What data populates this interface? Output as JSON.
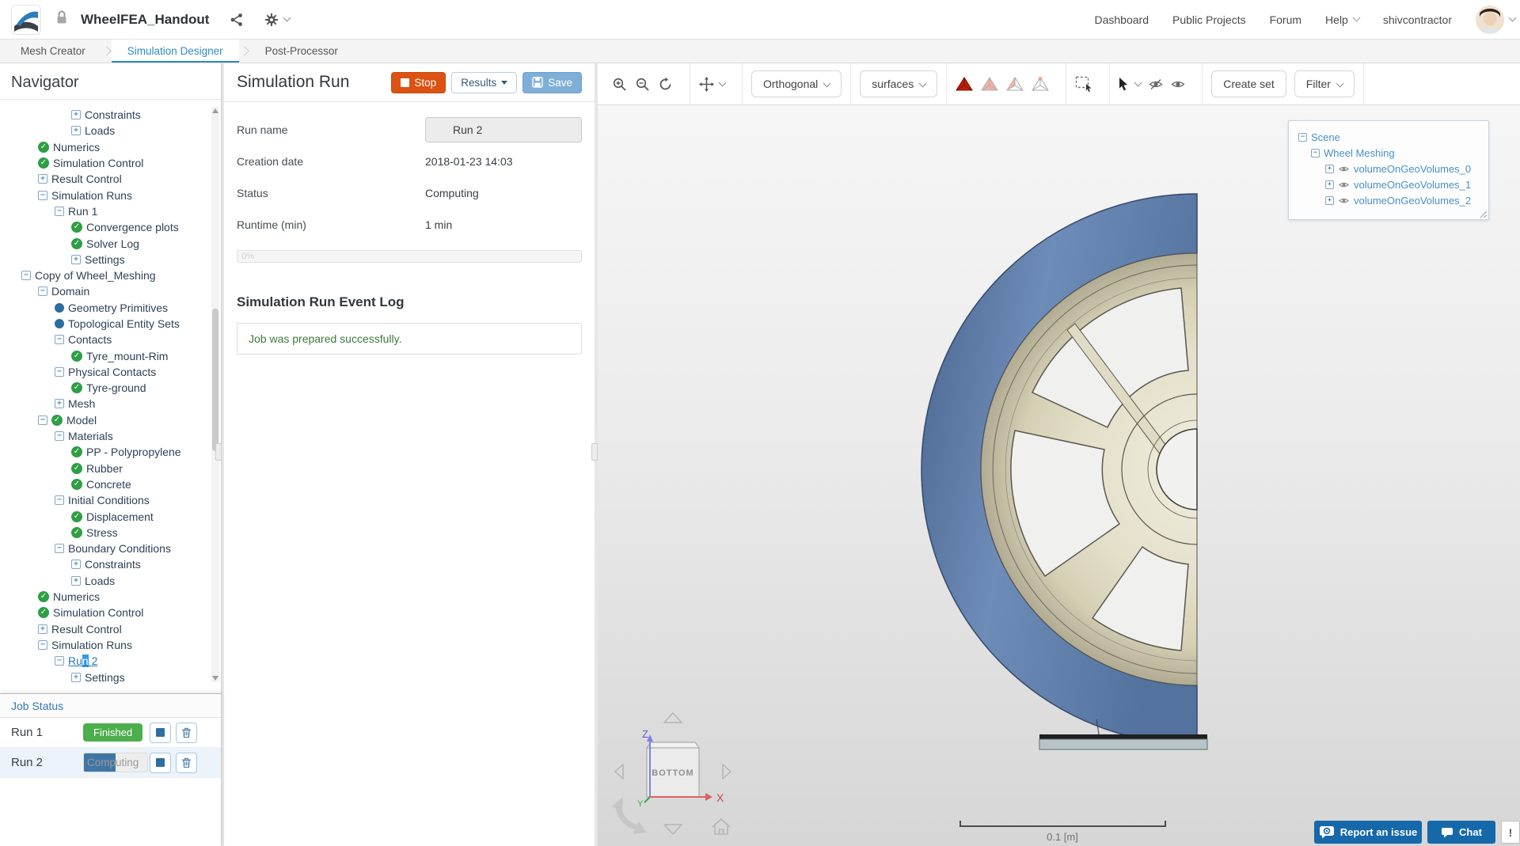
{
  "colors": {
    "accent_blue": "#2f8ac2",
    "stop_orange": "#dc5212",
    "save_blue": "#7fafd6",
    "finished_green": "#4cae4c",
    "progress_blue": "#4076a5",
    "tree_text": "#2e4154",
    "link_blue": "#4a90c7",
    "check_green": "#2f9e44",
    "dot_blue": "#2a6d9e",
    "report_blue": "#1568a9",
    "tire_blue": "#5b7aa8",
    "rim_beige": "#ddd8c0"
  },
  "header": {
    "title": "WheelFEA_Handout",
    "nav": [
      {
        "label": "Dashboard",
        "caret": false
      },
      {
        "label": "Public Projects",
        "caret": false
      },
      {
        "label": "Forum",
        "caret": false
      },
      {
        "label": "Help",
        "caret": true
      }
    ],
    "username": "shivcontractor"
  },
  "tabs": [
    {
      "label": "Mesh Creator",
      "active": false
    },
    {
      "label": "Simulation Designer",
      "active": true
    },
    {
      "label": "Post-Processor",
      "active": false
    }
  ],
  "navigator": {
    "title": "Navigator",
    "items": [
      {
        "l": "Constraints",
        "i": 3,
        "k": "plus"
      },
      {
        "l": "Loads",
        "i": 3,
        "k": "plus"
      },
      {
        "l": "Numerics",
        "i": 1,
        "k": "check"
      },
      {
        "l": "Simulation Control",
        "i": 1,
        "k": "check"
      },
      {
        "l": "Result Control",
        "i": 1,
        "k": "plus"
      },
      {
        "l": "Simulation Runs",
        "i": 1,
        "k": "minus"
      },
      {
        "l": "Run 1",
        "i": 2,
        "k": "minus"
      },
      {
        "l": "Convergence plots",
        "i": 3,
        "k": "check"
      },
      {
        "l": "Solver Log",
        "i": 3,
        "k": "check"
      },
      {
        "l": "Settings",
        "i": 3,
        "k": "plus"
      },
      {
        "l": "Copy of Wheel_Meshing",
        "i": 0,
        "k": "minus"
      },
      {
        "l": "Domain",
        "i": 1,
        "k": "minus"
      },
      {
        "l": "Geometry Primitives",
        "i": 2,
        "k": "dot"
      },
      {
        "l": "Topological Entity Sets",
        "i": 2,
        "k": "dot"
      },
      {
        "l": "Contacts",
        "i": 2,
        "k": "minus"
      },
      {
        "l": "Tyre_mount-Rim",
        "i": 3,
        "k": "check"
      },
      {
        "l": "Physical Contacts",
        "i": 2,
        "k": "minus"
      },
      {
        "l": "Tyre-ground",
        "i": 3,
        "k": "check"
      },
      {
        "l": "Mesh",
        "i": 2,
        "k": "plus"
      },
      {
        "l": "Model",
        "i": 1,
        "k": "mcheck"
      },
      {
        "l": "Materials",
        "i": 2,
        "k": "minus"
      },
      {
        "l": "PP - Polypropylene",
        "i": 3,
        "k": "check"
      },
      {
        "l": "Rubber",
        "i": 3,
        "k": "check"
      },
      {
        "l": "Concrete",
        "i": 3,
        "k": "check"
      },
      {
        "l": "Initial Conditions",
        "i": 2,
        "k": "minus"
      },
      {
        "l": "Displacement",
        "i": 3,
        "k": "check"
      },
      {
        "l": "Stress",
        "i": 3,
        "k": "check"
      },
      {
        "l": "Boundary Conditions",
        "i": 2,
        "k": "minus"
      },
      {
        "l": "Constraints",
        "i": 3,
        "k": "plus"
      },
      {
        "l": "Loads",
        "i": 3,
        "k": "plus"
      },
      {
        "l": "Numerics",
        "i": 1,
        "k": "check"
      },
      {
        "l": "Simulation Control",
        "i": 1,
        "k": "check"
      },
      {
        "l": "Result Control",
        "i": 1,
        "k": "plus"
      },
      {
        "l": "Simulation Runs",
        "i": 1,
        "k": "minus"
      },
      {
        "l": "Run 2",
        "i": 2,
        "k": "minus",
        "sel": true,
        "parts": [
          "Ru",
          "n",
          " 2"
        ]
      },
      {
        "l": "Settings",
        "i": 3,
        "k": "plus"
      }
    ]
  },
  "job_status": {
    "title": "Job Status",
    "rows": [
      {
        "name": "Run 1",
        "status": "Finished",
        "kind": "badge"
      },
      {
        "name": "Run 2",
        "status": "Computing",
        "kind": "progress",
        "progress_pct": 50
      }
    ]
  },
  "run_panel": {
    "title": "Simulation Run",
    "buttons": {
      "stop": "Stop",
      "results": "Results",
      "save": "Save"
    },
    "fields": [
      {
        "label": "Run name",
        "value": "Run 2",
        "kind": "input"
      },
      {
        "label": "Creation date",
        "value": "2018-01-23 14:03",
        "kind": "text"
      },
      {
        "label": "Status",
        "value": "Computing",
        "kind": "text"
      },
      {
        "label": "Runtime (min)",
        "value": "1 min",
        "kind": "text"
      }
    ],
    "progress": {
      "pct": 0,
      "text": "0%"
    },
    "event_log": {
      "title": "Simulation Run Event Log",
      "message": "Job was prepared successfully."
    }
  },
  "viewport": {
    "toolbar": {
      "projection": "Orthogonal",
      "display_mode": "surfaces",
      "create_set": "Create set",
      "filter": "Filter"
    },
    "scene_tree": {
      "root": "Scene",
      "group": "Wheel Meshing",
      "volumes": [
        "volumeOnGeoVolumes_0",
        "volumeOnGeoVolumes_1",
        "volumeOnGeoVolumes_2"
      ]
    },
    "orientation": {
      "face_label": "BOTTOM",
      "axis_x": "X",
      "axis_y": "Y",
      "axis_z": "Z"
    },
    "scale_bar": "0.1 [m]",
    "buttons": {
      "report": "Report an issue",
      "chat": "Chat",
      "alert": "!"
    }
  }
}
